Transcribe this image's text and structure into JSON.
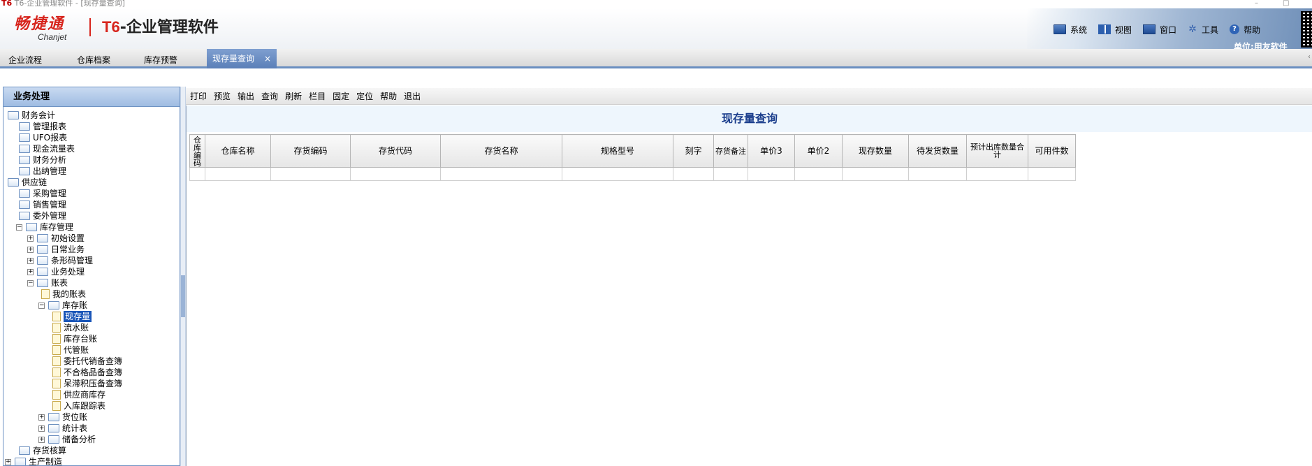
{
  "window": {
    "title_logo": "T6",
    "title_text": "T6-企业管理软件 - [现存量查询]",
    "controls": [
      "–",
      "□"
    ]
  },
  "header": {
    "brand_cn": "畅捷通",
    "brand_en": "Chanjet",
    "product_t6": "T6",
    "product_name": "-企业管理软件",
    "menu": [
      "系统",
      "视图",
      "窗口",
      "工具",
      "帮助"
    ],
    "unit_label": "单位:用友软件"
  },
  "tabs": [
    {
      "label": "企业流程"
    },
    {
      "label": "仓库档案"
    },
    {
      "label": "库存预警"
    },
    {
      "label": "现存量查询",
      "close": "×"
    }
  ],
  "left_panel": {
    "title": "业务处理",
    "tree": [
      {
        "label": "财务会计",
        "level": 0,
        "exp": ""
      },
      {
        "label": "管理报表",
        "level": 1,
        "exp": ""
      },
      {
        "label": "UFO报表",
        "level": 1,
        "exp": ""
      },
      {
        "label": "现金流量表",
        "level": 1,
        "exp": ""
      },
      {
        "label": "财务分析",
        "level": 1,
        "exp": ""
      },
      {
        "label": "出纳管理",
        "level": 1,
        "exp": ""
      },
      {
        "label": "供应链",
        "level": 0,
        "exp": ""
      },
      {
        "label": "采购管理",
        "level": 1,
        "exp": ""
      },
      {
        "label": "销售管理",
        "level": 1,
        "exp": ""
      },
      {
        "label": "委外管理",
        "level": 1,
        "exp": ""
      },
      {
        "label": "库存管理",
        "level": 1,
        "exp": "−"
      },
      {
        "label": "初始设置",
        "level": 2,
        "exp": "+"
      },
      {
        "label": "日常业务",
        "level": 2,
        "exp": "+"
      },
      {
        "label": "条形码管理",
        "level": 2,
        "exp": "+"
      },
      {
        "label": "业务处理",
        "level": 2,
        "exp": "+"
      },
      {
        "label": "账表",
        "level": 2,
        "exp": "−"
      },
      {
        "label": "我的账表",
        "level": 3,
        "exp": "",
        "doc": true
      },
      {
        "label": "库存账",
        "level": 3,
        "exp": "−"
      },
      {
        "label": "现存量",
        "level": 4,
        "exp": "",
        "doc": true,
        "selected": true
      },
      {
        "label": "流水账",
        "level": 4,
        "exp": "",
        "doc": true
      },
      {
        "label": "库存台账",
        "level": 4,
        "exp": "",
        "doc": true
      },
      {
        "label": "代管账",
        "level": 4,
        "exp": "",
        "doc": true
      },
      {
        "label": "委托代销备查簿",
        "level": 4,
        "exp": "",
        "doc": true
      },
      {
        "label": "不合格品备查簿",
        "level": 4,
        "exp": "",
        "doc": true
      },
      {
        "label": "呆滞积压备查簿",
        "level": 4,
        "exp": "",
        "doc": true
      },
      {
        "label": "供应商库存",
        "level": 4,
        "exp": "",
        "doc": true
      },
      {
        "label": "入库跟踪表",
        "level": 4,
        "exp": "",
        "doc": true
      },
      {
        "label": "货位账",
        "level": 3,
        "exp": "+"
      },
      {
        "label": "统计表",
        "level": 3,
        "exp": "+"
      },
      {
        "label": "储备分析",
        "level": 3,
        "exp": "+"
      },
      {
        "label": "存货核算",
        "level": 1,
        "exp": ""
      },
      {
        "label": "生产制造",
        "level": 0,
        "exp": "+"
      }
    ]
  },
  "toolbar": [
    "打印",
    "预览",
    "输出",
    "查询",
    "刷新",
    "栏目",
    "固定",
    "定位",
    "帮助",
    "退出"
  ],
  "report": {
    "title": "现存量查询",
    "columns": [
      "仓库编码",
      "仓库名称",
      "存货编码",
      "存货代码",
      "存货名称",
      "规格型号",
      "刻字",
      "存货备注",
      "单价3",
      "单价2",
      "现存数量",
      "待发货数量",
      "预计出库数量合计",
      "可用件数"
    ]
  }
}
